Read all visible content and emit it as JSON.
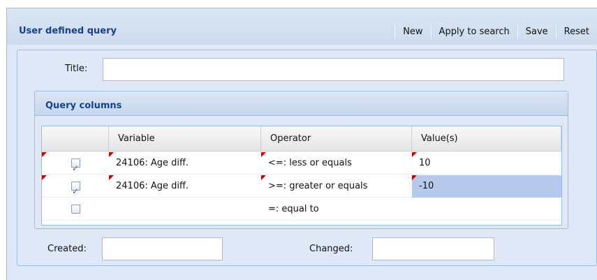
{
  "panel": {
    "title": "User defined query",
    "toolbar": {
      "new": "New",
      "apply": "Apply to search",
      "save": "Save",
      "reset": "Reset"
    }
  },
  "form": {
    "title_label": "Title:",
    "title_value": "",
    "created_label": "Created:",
    "created_value": "",
    "changed_label": "Changed:",
    "changed_value": ""
  },
  "query_columns": {
    "title": "Query columns",
    "headers": {
      "variable": "Variable",
      "operator": "Operator",
      "values": "Value(s)"
    },
    "rows": [
      {
        "checked": true,
        "variable": "24106: Age diff.",
        "operator": "<=: less or equals",
        "value": "10"
      },
      {
        "checked": true,
        "variable": "24106: Age diff.",
        "operator": ">=: greater or equals",
        "value": "-10"
      },
      {
        "checked": false,
        "variable": "",
        "operator": "=: equal to",
        "value": ""
      }
    ]
  },
  "colors": {
    "panel_bg": "#dfe8f6",
    "header_text": "#15428b",
    "border": "#99bbe8",
    "selection": "#b7c9ed",
    "dirty_marker": "#cc0000"
  }
}
